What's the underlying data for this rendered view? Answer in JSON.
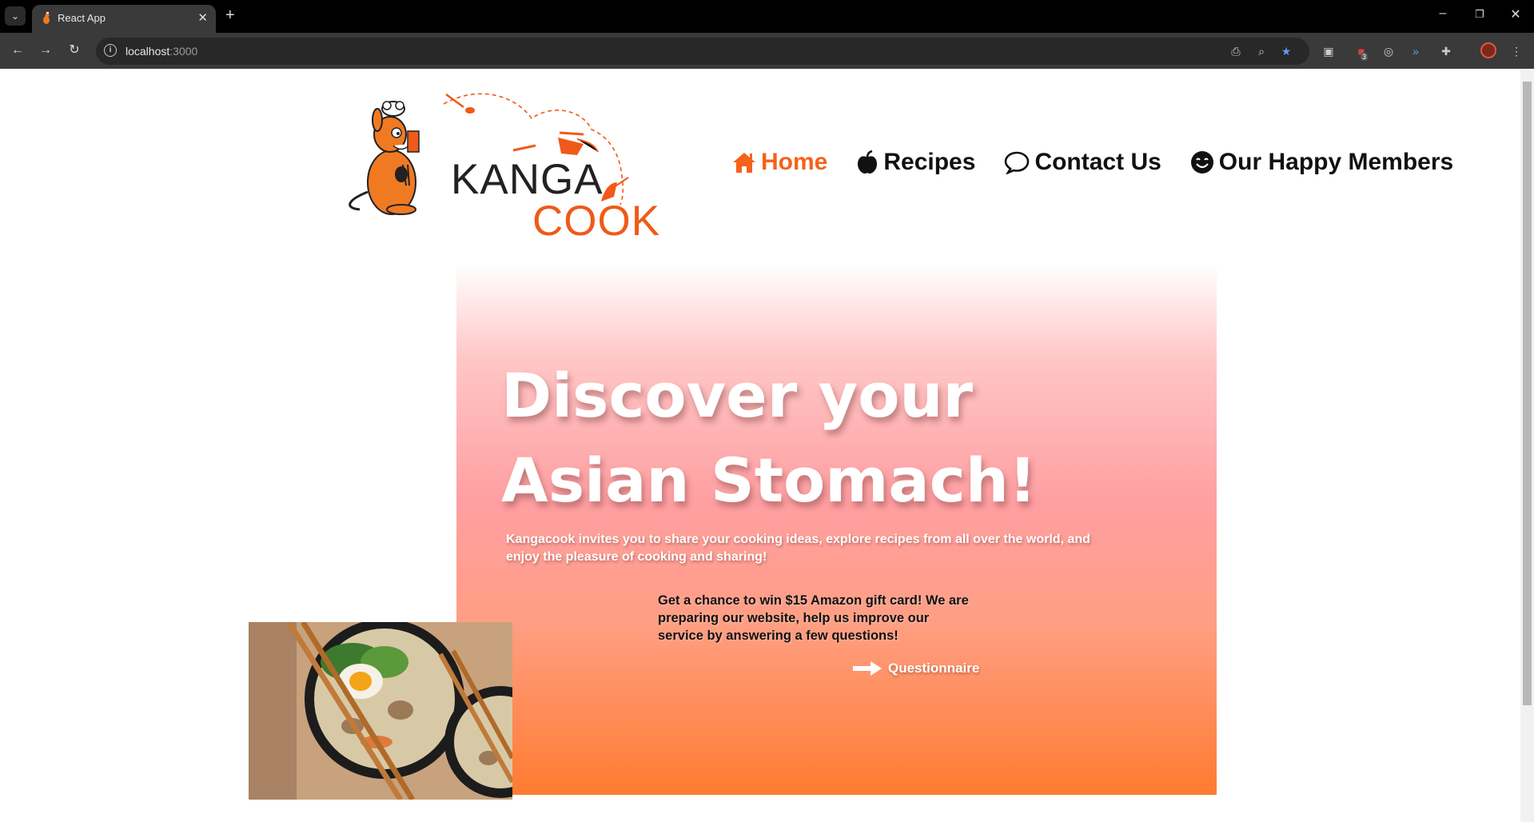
{
  "browser": {
    "tab_title": "React App",
    "url_host": "localhost",
    "url_port": ":3000",
    "extension_badge": "3"
  },
  "logo": {
    "line1": "KANGA",
    "line2": "COOK"
  },
  "nav": {
    "items": [
      {
        "label": "Home",
        "icon": "home-icon",
        "active": true
      },
      {
        "label": "Recipes",
        "icon": "apple-icon",
        "active": false
      },
      {
        "label": "Contact Us",
        "icon": "speech-bubble-icon",
        "active": false
      },
      {
        "label": "Our Happy Members",
        "icon": "smile-icon",
        "active": false
      }
    ]
  },
  "hero": {
    "title": "Discover your Asian Stomach!",
    "subtitle": "Kangacook invites you to share your cooking ideas, explore recipes from all over the world, and enjoy the pleasure of cooking and sharing!",
    "gift_text": "Get a chance to win $15 Amazon gift card! We are preparing our website, help us improve our service by answering a few questions!",
    "cta_label": "Questionnaire"
  },
  "colors": {
    "accent": "#f5621a",
    "hero_top": "#ffc6c6",
    "hero_bottom": "#ff7b30"
  }
}
